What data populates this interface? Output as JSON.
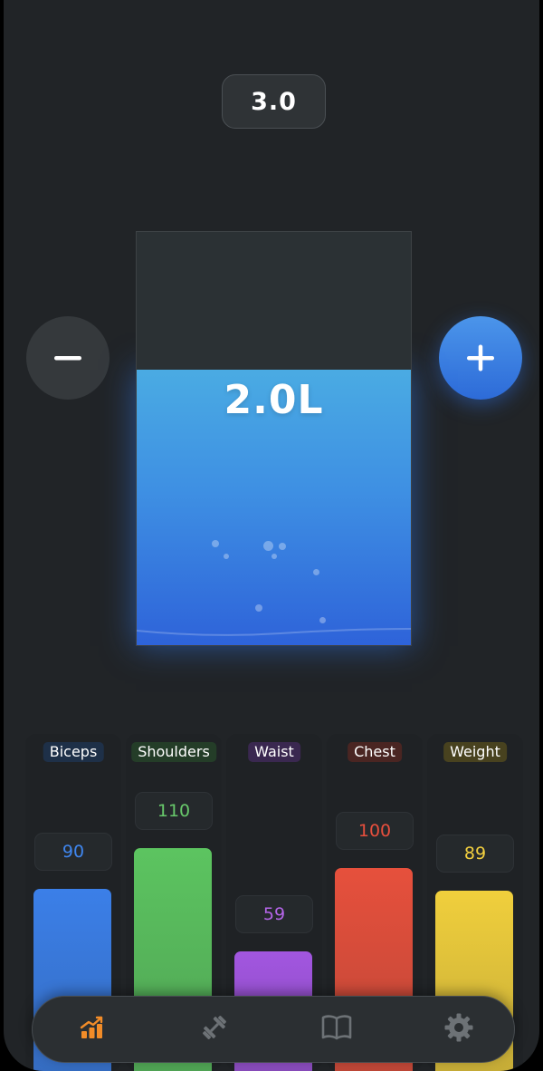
{
  "goal": {
    "value": "3.0"
  },
  "water": {
    "amount_label": "2.0L",
    "level_fraction": 0.667,
    "fill_color_top": "#4aabe3",
    "fill_color_bottom": "#2e63d9"
  },
  "controls": {
    "decrease_icon": "minus-icon",
    "increase_icon": "plus-icon",
    "accent": "#3b82e6"
  },
  "stats": [
    {
      "name": "Biceps",
      "value": "90",
      "color": "#3b7fe8",
      "label_bg": "#1e3048",
      "val_color": "#3f86ef"
    },
    {
      "name": "Shoulders",
      "value": "110",
      "color": "#5cc460",
      "label_bg": "#243d28",
      "val_color": "#68c96b"
    },
    {
      "name": "Waist",
      "value": "59",
      "color": "#a256e0",
      "label_bg": "#3a2850",
      "val_color": "#b565e9"
    },
    {
      "name": "Chest",
      "value": "100",
      "color": "#e6503c",
      "label_bg": "#4a2522",
      "val_color": "#e84f3d"
    },
    {
      "name": "Weight",
      "value": "89",
      "color": "#f0cf3c",
      "label_bg": "#48421f",
      "val_color": "#f3d03f"
    }
  ],
  "tabs": [
    {
      "icon": "stats-chart-icon",
      "active": true,
      "color": "#f28c28"
    },
    {
      "icon": "dumbbell-icon",
      "active": false,
      "color": "#6d7276"
    },
    {
      "icon": "book-icon",
      "active": false,
      "color": "#6d7276"
    },
    {
      "icon": "gear-icon",
      "active": false,
      "color": "#6d7276"
    }
  ]
}
